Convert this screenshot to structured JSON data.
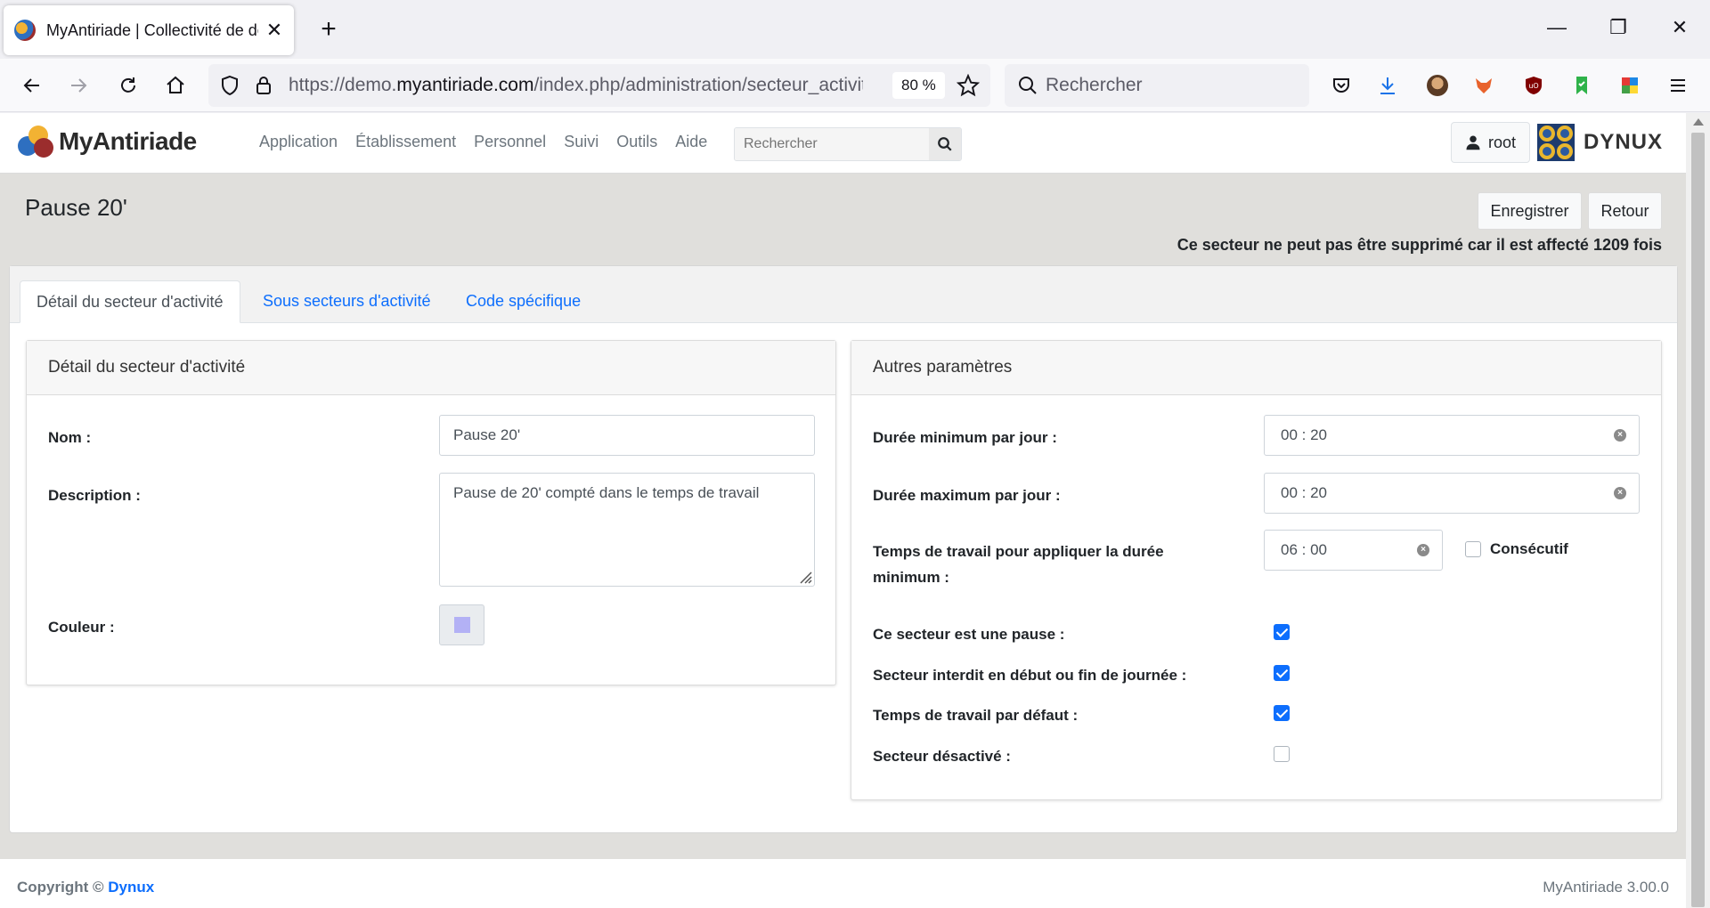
{
  "browser": {
    "tab_title": "MyAntiriade | Collectivité de dé",
    "url_prefix": "https://demo.",
    "url_domain": "myantiriade.com",
    "url_path": "/index.php/administration/secteur_activite",
    "zoom": "80 %",
    "search_placeholder": "Rechercher"
  },
  "header": {
    "logo_text": "MyAntiriade",
    "menu": [
      "Application",
      "Établissement",
      "Personnel",
      "Suivi",
      "Outils",
      "Aide"
    ],
    "search_placeholder": "Rechercher",
    "user": "root",
    "brand": "DYNUX"
  },
  "page": {
    "title": "Pause 20'",
    "save_label": "Enregistrer",
    "back_label": "Retour",
    "warning": "Ce secteur ne peut pas être supprimé car il est affecté 1209 fois"
  },
  "tabs": [
    "Détail du secteur d'activité",
    "Sous secteurs d'activité",
    "Code spécifique"
  ],
  "detail_panel": {
    "title": "Détail du secteur d'activité",
    "name_label": "Nom :",
    "name_value": "Pause 20'",
    "description_label": "Description :",
    "description_value": "Pause de 20' compté dans le temps de travail",
    "color_label": "Couleur :",
    "color_value": "#b3b1f5"
  },
  "params_panel": {
    "title": "Autres paramètres",
    "min_label": "Durée minimum par jour :",
    "min_value": "00 : 20",
    "max_label": "Durée maximum par jour :",
    "max_value": "00 : 20",
    "work_label": "Temps de travail pour appliquer la durée minimum :",
    "work_value": "06 : 00",
    "consecutive_label": "Consécutif",
    "consecutive_checked": false,
    "checks": [
      {
        "label": "Ce secteur est une pause :",
        "checked": true
      },
      {
        "label": "Secteur interdit en début ou fin de journée :",
        "checked": true
      },
      {
        "label": "Temps de travail par défaut :",
        "checked": true
      },
      {
        "label": "Secteur désactivé :",
        "checked": false
      }
    ]
  },
  "footer": {
    "copyright": "Copyright ©",
    "company": "Dynux",
    "version": "MyAntiriade 3.00.0"
  },
  "colors": {
    "accent": "#0d6efd",
    "page_bg": "#e0dfdc"
  }
}
